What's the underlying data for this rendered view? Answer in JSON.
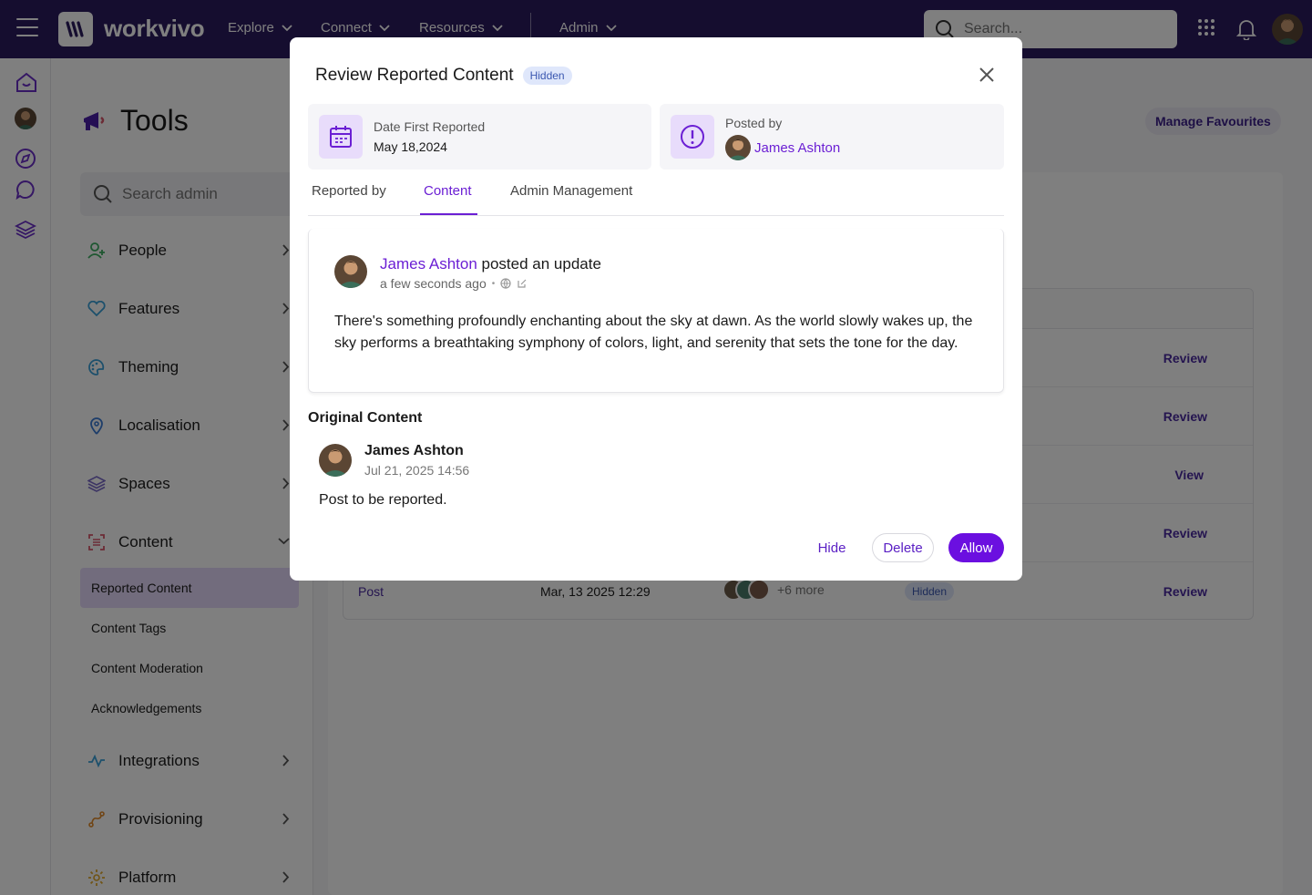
{
  "topbar": {
    "logo": "workvivo",
    "nav": [
      "Explore",
      "Connect",
      "Resources",
      "Admin"
    ],
    "search_placeholder": "Search..."
  },
  "sidebar": {
    "title": "Tools",
    "search_placeholder": "Search admin",
    "items": [
      {
        "label": "People",
        "icon": "user-plus-icon",
        "color": "#3fae63"
      },
      {
        "label": "Features",
        "icon": "heart-icon",
        "color": "#3aa0d8"
      },
      {
        "label": "Theming",
        "icon": "palette-icon",
        "color": "#3aa0d8"
      },
      {
        "label": "Localisation",
        "icon": "map-pin-icon",
        "color": "#3a7bd5"
      },
      {
        "label": "Spaces",
        "icon": "layers-icon",
        "color": "#7a6ac8"
      },
      {
        "label": "Content",
        "icon": "content-scan-icon",
        "color": "#d8566a"
      },
      {
        "label": "Integrations",
        "icon": "activity-icon",
        "color": "#3aa0d8"
      },
      {
        "label": "Provisioning",
        "icon": "route-icon",
        "color": "#e08a2a"
      },
      {
        "label": "Platform",
        "icon": "gear-icon",
        "color": "#e0a82a"
      }
    ],
    "content_sub": [
      "Reported Content",
      "Content Tags",
      "Content Moderation",
      "Acknowledgements"
    ]
  },
  "main": {
    "manage_favourites": "Manage Favourites",
    "rows": [
      {
        "action": "Review"
      },
      {
        "action": "Review"
      },
      {
        "action": "View"
      },
      {
        "action": "Review"
      },
      {
        "type": "Post",
        "date": "Mar, 13 2025 12:29",
        "more": "+6 more",
        "status": "Hidden",
        "action": "Review"
      }
    ]
  },
  "modal": {
    "title": "Review Reported Content",
    "badge": "Hidden",
    "date_label": "Date First Reported",
    "date_value": "May 18,2024",
    "posted_by_label": "Posted by",
    "posted_by_name": "James Ashton",
    "tabs": [
      "Reported by",
      "Content",
      "Admin Management"
    ],
    "active_tab": "Content",
    "post": {
      "author": "James Ashton",
      "action": "posted an update",
      "time": "a few seconds ago",
      "body": "There's something profoundly enchanting about the sky at dawn. As the world slowly wakes up, the sky performs a breathtaking symphony of colors, light, and serenity that sets the tone for the day."
    },
    "original": {
      "heading": "Original Content",
      "author": "James Ashton",
      "date": "Jul 21, 2025 14:56",
      "body": "Post to be reported."
    },
    "buttons": {
      "hide": "Hide",
      "delete": "Delete",
      "allow": "Allow"
    }
  },
  "colors": {
    "brand": "#2a1a5e",
    "accent": "#6b0fe0",
    "hidden_badge_bg": "#dfe7fb"
  }
}
